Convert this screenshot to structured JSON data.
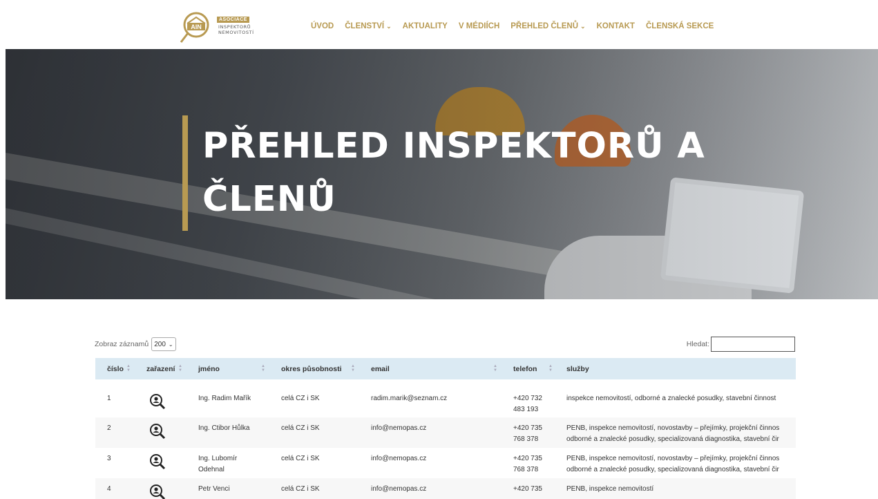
{
  "logo": {
    "badge": "ASOCIACE",
    "line1": "INSPEKTORŮ",
    "line2": "NEMOVITOSTÍ",
    "mark": "AIN",
    "accent": "#b89a52"
  },
  "nav": [
    {
      "label": "ÚVOD",
      "dropdown": false
    },
    {
      "label": "ČLENSTVÍ",
      "dropdown": true
    },
    {
      "label": "AKTUALITY",
      "dropdown": false
    },
    {
      "label": "V MÉDIÍCH",
      "dropdown": false
    },
    {
      "label": "PŘEHLED ČLENŮ",
      "dropdown": true
    },
    {
      "label": "KONTAKT",
      "dropdown": false
    },
    {
      "label": "ČLENSKÁ SEKCE",
      "dropdown": false
    }
  ],
  "hero": {
    "title_line1": "PŘEHLED INSPEKTORŮ A",
    "title_line2": "ČLENŮ"
  },
  "controls": {
    "length_label": "Zobraz záznamů",
    "length_value": "200",
    "search_label": "Hledat:",
    "search_value": ""
  },
  "table": {
    "columns": [
      "číslo",
      "zařazení",
      "jméno",
      "okres působnosti",
      "email",
      "telefon",
      "služby"
    ],
    "rows": [
      {
        "cislo": "1",
        "zarazeni_icon": "inspector-icon",
        "jmeno": [
          "Ing. Radim Mařík"
        ],
        "okres": "celá CZ i SK",
        "email": "radim.marik@seznam.cz",
        "telefon": [
          "+420 732",
          "483 193"
        ],
        "sluzby": [
          "inspekce nemovitostí, odborné a znalecké posudky, stavební činnost"
        ]
      },
      {
        "cislo": "2",
        "zarazeni_icon": "inspector-icon",
        "jmeno": [
          "Ing. Ctibor Hůlka"
        ],
        "okres": "celá CZ i SK",
        "email": "info@nemopas.cz",
        "telefon": [
          "+420 735",
          "768 378"
        ],
        "sluzby": [
          "PENB, inspekce nemovitostí, novostavby – přejímky, projekční činnos",
          "odborné a znalecké posudky, specializovaná diagnostika, stavební čir"
        ]
      },
      {
        "cislo": "3",
        "zarazeni_icon": "inspector-icon",
        "jmeno": [
          "Ing. Lubomír",
          "Odehnal"
        ],
        "okres": "celá CZ i SK",
        "email": "info@nemopas.cz",
        "telefon": [
          "+420 735",
          "768 378"
        ],
        "sluzby": [
          "PENB, inspekce nemovitostí, novostavby – přejímky, projekční činnos",
          "odborné a znalecké posudky, specializovaná diagnostika, stavební čir"
        ]
      },
      {
        "cislo": "4",
        "zarazeni_icon": "inspector-icon",
        "jmeno": [
          "Petr Venci"
        ],
        "okres": "celá CZ i SK",
        "email": "info@nemopas.cz",
        "telefon": [
          "+420 735"
        ],
        "sluzby": [
          "PENB, inspekce nemovitostí"
        ]
      }
    ]
  }
}
